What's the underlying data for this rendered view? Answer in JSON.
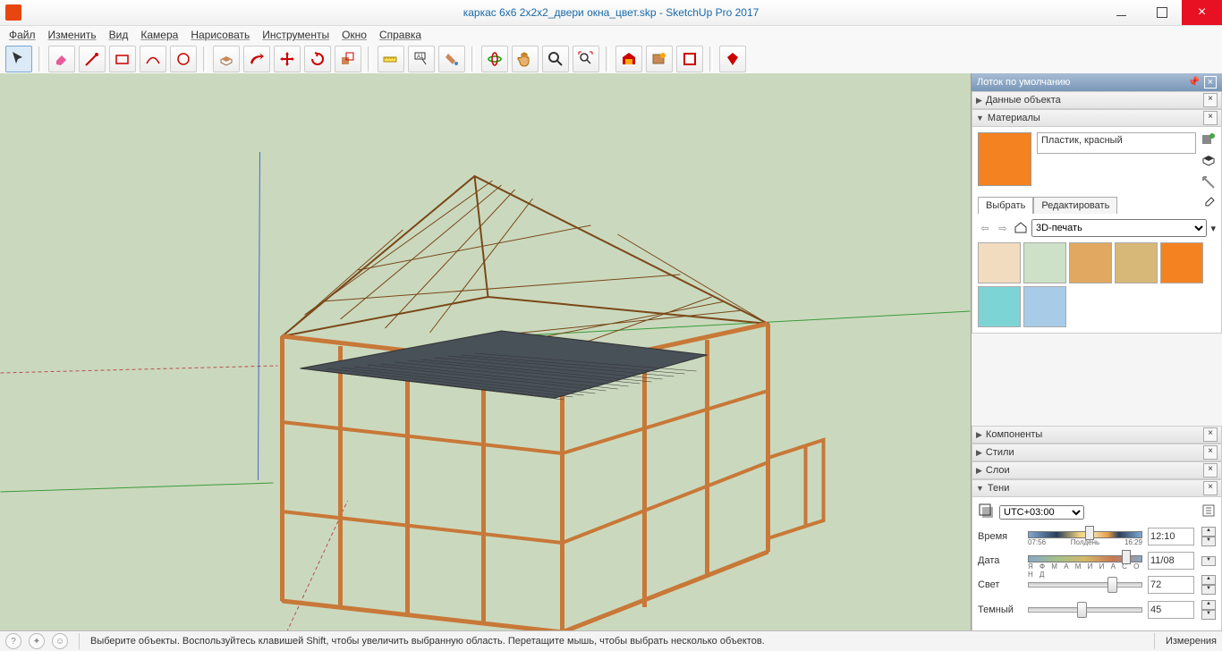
{
  "title": "каркас 6x6 2x2x2_двери окна_цвет.skp - SketchUp Pro 2017",
  "menu": [
    "Файл",
    "Изменить",
    "Вид",
    "Камера",
    "Нарисовать",
    "Инструменты",
    "Окно",
    "Справка"
  ],
  "tray": {
    "title": "Лоток по умолчанию"
  },
  "panels": {
    "entity": "Данные объекта",
    "materials": "Материалы",
    "components": "Компоненты",
    "styles": "Стили",
    "layers": "Слои",
    "shadows": "Тени"
  },
  "materials": {
    "name": "Пластик, красный",
    "tabs": [
      "Выбрать",
      "Редактировать"
    ],
    "library": "3D-печать",
    "swatch_colors": [
      "#f2dcc0",
      "#cde0c8",
      "#e0a860",
      "#d8b878",
      "#f58220",
      "#7cd4d4",
      "#a8cce8"
    ]
  },
  "shadows": {
    "tz": "UTC+03:00",
    "time_label": "Время",
    "time_start": "07:56",
    "time_noon": "Полдень",
    "time_end": "16:29",
    "time_val": "12:10",
    "date_label": "Дата",
    "date_months": "Я Ф М А М И И А С О Н Д",
    "date_val": "11/08",
    "light_label": "Свет",
    "light_val": "72",
    "dark_label": "Темный",
    "dark_val": "45"
  },
  "status": {
    "hint": "Выберите объекты. Воспользуйтесь клавишей Shift, чтобы увеличить выбранную область. Перетащите мышь, чтобы выбрать несколько объектов.",
    "measure_label": "Измерения"
  }
}
